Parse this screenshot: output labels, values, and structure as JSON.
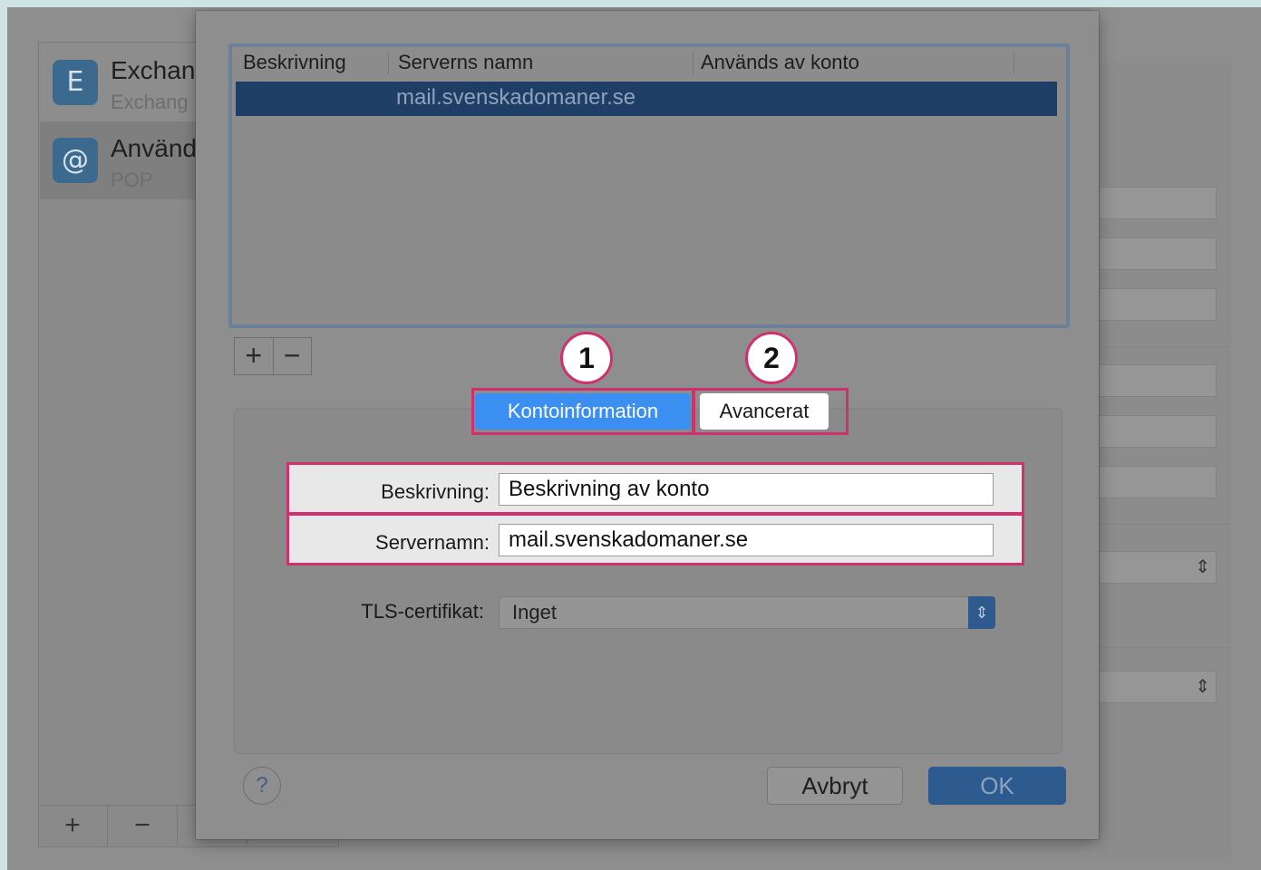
{
  "background": {
    "accounts": [
      {
        "name": "Exchan",
        "type": "Exchang",
        "icon": "exchange-icon"
      },
      {
        "name": "Använd",
        "type": "POP",
        "icon": "at-sign-icon"
      }
    ],
    "bottom_bar": {
      "add": "+",
      "remove": "−"
    }
  },
  "server_table": {
    "columns": [
      "Beskrivning",
      "Serverns namn",
      "Används av konto"
    ],
    "rows": [
      {
        "description": "",
        "server": "mail.svenskadomaner.se",
        "used_by": "",
        "selected": true
      }
    ],
    "add_label": "+",
    "remove_label": "−"
  },
  "annotations": {
    "badge1": "1",
    "badge2": "2"
  },
  "tabs": {
    "account_info": "Kontoinformation",
    "advanced": "Avancerat",
    "selected": "account_info"
  },
  "form": {
    "description_label": "Beskrivning:",
    "description_value": "Beskrivning av konto",
    "server_label": "Servernamn:",
    "server_value": "mail.svenskadomaner.se",
    "tls_label": "TLS-certifikat:",
    "tls_value": "Inget"
  },
  "buttons": {
    "help": "?",
    "cancel": "Avbryt",
    "ok": "OK"
  },
  "colors": {
    "highlight": "#d0306b",
    "accent": "#3b8ff0",
    "selection": "#1f3e66"
  }
}
